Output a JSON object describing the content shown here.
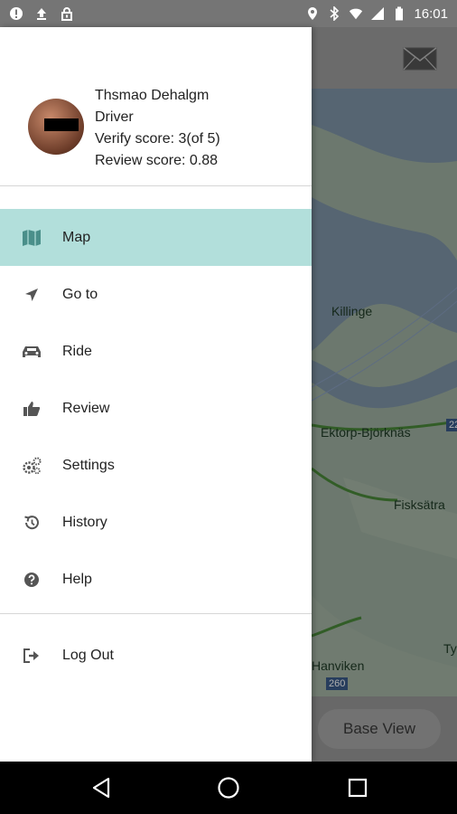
{
  "status_bar": {
    "time": "16:01",
    "left_icons": [
      "alert-icon",
      "upload-icon",
      "lock-icon"
    ],
    "right_icons": [
      "location-icon",
      "bluetooth-icon",
      "wifi-icon",
      "signal-icon",
      "battery-icon"
    ]
  },
  "drawer": {
    "profile": {
      "name": "Thsmao Dehalgm",
      "role": "Driver",
      "verify_score": "Verify score: 3(of 5)",
      "review_score": "Review score: 0.88"
    },
    "items": [
      {
        "label": "Map",
        "icon": "map-icon",
        "active": true
      },
      {
        "label": "Go to",
        "icon": "navigation-arrow-icon",
        "active": false
      },
      {
        "label": "Ride",
        "icon": "car-icon",
        "active": false
      },
      {
        "label": "Review",
        "icon": "thumbs-up-icon",
        "active": false
      },
      {
        "label": "Settings",
        "icon": "gears-icon",
        "active": false
      },
      {
        "label": "History",
        "icon": "history-icon",
        "active": false
      },
      {
        "label": "Help",
        "icon": "help-icon",
        "active": false
      }
    ],
    "logout": {
      "label": "Log Out",
      "icon": "logout-icon"
    }
  },
  "map": {
    "labels": {
      "killinge": "Killinge",
      "ektorp": "Ektorp-Björknäs",
      "fisksatra": "Fisksätra",
      "hanviken": "Hanviken",
      "ty": "Ty"
    },
    "road_badges": [
      "260",
      "22"
    ]
  },
  "bottom": {
    "base_view_label": "Base View"
  },
  "colors": {
    "accent": "#b2dfdb",
    "icon": "#555555",
    "status_bar": "#757575"
  }
}
